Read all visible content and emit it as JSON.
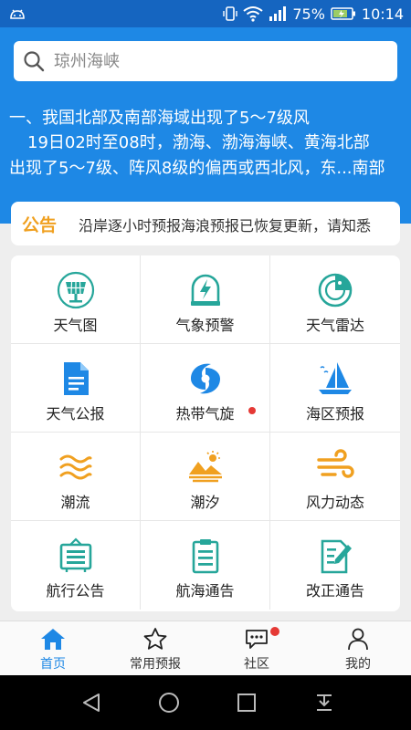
{
  "status_bar": {
    "battery_percent": "75%",
    "time": "10:14"
  },
  "search": {
    "placeholder": "琼州海峡"
  },
  "news": {
    "title": "一、我国北部及南部海域出现了5～7级风",
    "line1": "19日02时至08时，渤海、渤海海峡、黄海北部",
    "line2": "出现了5～7级、阵风8级的偏西或西北风，东...南部"
  },
  "notice": {
    "label": "公告",
    "text": "沿岸逐小时预报海浪预报已恢复更新，请知悉"
  },
  "grid": {
    "items": [
      {
        "label": "天气图",
        "icon": "solar-panel-icon"
      },
      {
        "label": "气象预警",
        "icon": "warning-bolt-icon"
      },
      {
        "label": "天气雷达",
        "icon": "radar-icon"
      },
      {
        "label": "天气公报",
        "icon": "document-icon"
      },
      {
        "label": "热带气旋",
        "icon": "typhoon-icon",
        "badge": true
      },
      {
        "label": "海区预报",
        "icon": "sailboat-icon"
      },
      {
        "label": "潮流",
        "icon": "waves-icon"
      },
      {
        "label": "潮汐",
        "icon": "sunset-tide-icon"
      },
      {
        "label": "风力动态",
        "icon": "wind-icon"
      },
      {
        "label": "航行公告",
        "icon": "noticeboard-icon"
      },
      {
        "label": "航海通告",
        "icon": "clipboard-icon"
      },
      {
        "label": "改正通告",
        "icon": "edit-document-icon"
      }
    ]
  },
  "bottom_nav": {
    "items": [
      {
        "label": "首页",
        "icon": "home-icon",
        "active": true
      },
      {
        "label": "常用预报",
        "icon": "star-icon"
      },
      {
        "label": "社区",
        "icon": "chat-icon",
        "badge": true
      },
      {
        "label": "我的",
        "icon": "person-icon"
      }
    ]
  },
  "colors": {
    "primary": "#1e88e5",
    "accent": "#26a69a",
    "orange": "#f0a020",
    "badge": "#e53935"
  }
}
